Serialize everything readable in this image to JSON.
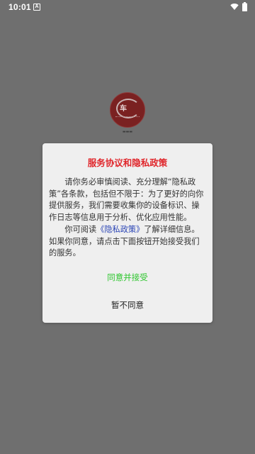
{
  "status_bar": {
    "time": "10:01",
    "notification_icon_label": "A",
    "icons": [
      "wifi-icon",
      "battery-icon"
    ]
  },
  "colors": {
    "overlay": "#6f6f6f",
    "dialog_bg": "#efefef",
    "title": "#e0262b",
    "link": "#2b45b5",
    "accept": "#2ec62e"
  },
  "dialog": {
    "title": "服务协议和隐私政策",
    "para1": "请你务必审慎阅读、充分理解“隐私政策”各条款，包括但不限于：为了更好的向你提供服务，我们需要收集你的设备标识、操作日志等信息用于分析、优化应用性能。",
    "para2_prefix": "你可阅读",
    "policy_link": "《隐私政策》",
    "para2_suffix": "了解详细信息。如果你同意，请点击下面按钮开始接受我们的服务。",
    "accept_label": "同意并接受",
    "decline_label": "暂不同意"
  }
}
